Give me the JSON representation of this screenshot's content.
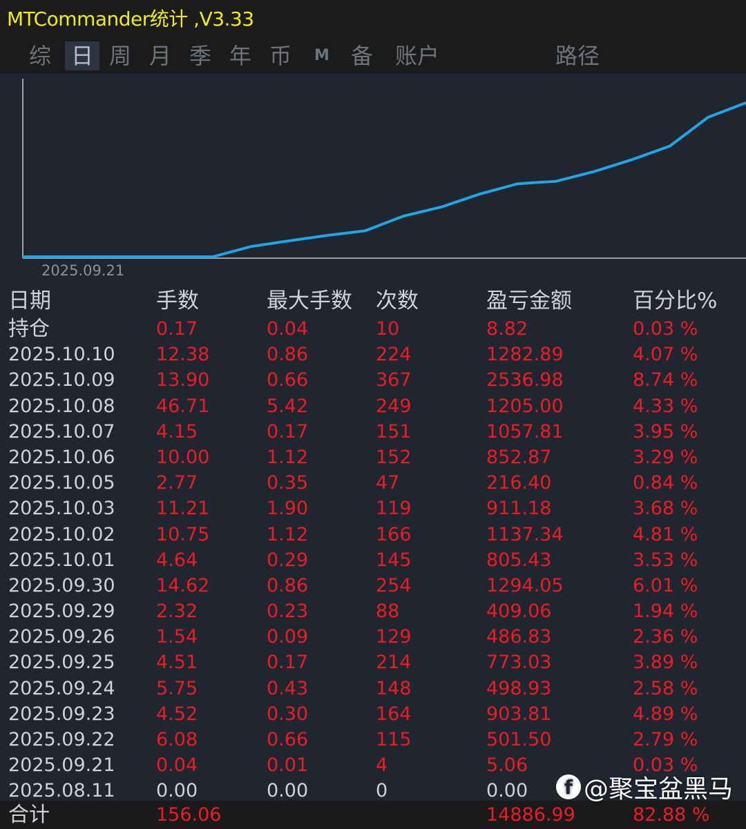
{
  "app": {
    "title": "MTCommander统计 ,V3.33"
  },
  "tabs": [
    {
      "label": "综",
      "active": false
    },
    {
      "label": "日",
      "active": true
    },
    {
      "label": "周",
      "active": false
    },
    {
      "label": "月",
      "active": false
    },
    {
      "label": "季",
      "active": false
    },
    {
      "label": "年",
      "active": false
    },
    {
      "label": "币",
      "active": false
    },
    {
      "label": "M",
      "active": false
    },
    {
      "label": "备",
      "active": false
    },
    {
      "label": "账户",
      "active": false
    },
    {
      "label": "路径",
      "active": false
    }
  ],
  "colors": {
    "title": "#f0f000",
    "line": "#1ea7e6",
    "profit": "#ec1c24",
    "text": "#cfd2d6",
    "background": "#202630"
  },
  "chart_data": {
    "type": "line",
    "x_start_label": "2025.09.21",
    "series": [
      {
        "values": [
          0,
          0,
          0,
          0,
          0,
          5.06,
          906.87,
          1405.8,
          1892.63,
          2301.69,
          3595.74,
          4401.17,
          5538.51,
          6449.69,
          6666.09,
          7518.96,
          8576.77,
          9781.77,
          12318.75,
          13601.64
        ]
      }
    ]
  },
  "table": {
    "headers": [
      "日期",
      "手数",
      "最大手数",
      "次数",
      "盈亏金额",
      "百分比%"
    ],
    "rows": [
      {
        "date": "持仓",
        "lots": "0.17",
        "max_lots": "0.04",
        "count": "10",
        "pnl": "8.82",
        "pct": "0.03 %",
        "red": true
      },
      {
        "date": "2025.10.10",
        "lots": "12.38",
        "max_lots": "0.86",
        "count": "224",
        "pnl": "1282.89",
        "pct": "4.07 %",
        "red": true
      },
      {
        "date": "2025.10.09",
        "lots": "13.90",
        "max_lots": "0.66",
        "count": "367",
        "pnl": "2536.98",
        "pct": "8.74 %",
        "red": true
      },
      {
        "date": "2025.10.08",
        "lots": "46.71",
        "max_lots": "5.42",
        "count": "249",
        "pnl": "1205.00",
        "pct": "4.33 %",
        "red": true
      },
      {
        "date": "2025.10.07",
        "lots": "4.15",
        "max_lots": "0.17",
        "count": "151",
        "pnl": "1057.81",
        "pct": "3.95 %",
        "red": true
      },
      {
        "date": "2025.10.06",
        "lots": "10.00",
        "max_lots": "1.12",
        "count": "152",
        "pnl": "852.87",
        "pct": "3.29 %",
        "red": true
      },
      {
        "date": "2025.10.05",
        "lots": "2.77",
        "max_lots": "0.35",
        "count": "47",
        "pnl": "216.40",
        "pct": "0.84 %",
        "red": true
      },
      {
        "date": "2025.10.03",
        "lots": "11.21",
        "max_lots": "1.90",
        "count": "119",
        "pnl": "911.18",
        "pct": "3.68 %",
        "red": true
      },
      {
        "date": "2025.10.02",
        "lots": "10.75",
        "max_lots": "1.12",
        "count": "166",
        "pnl": "1137.34",
        "pct": "4.81 %",
        "red": true
      },
      {
        "date": "2025.10.01",
        "lots": "4.64",
        "max_lots": "0.29",
        "count": "145",
        "pnl": "805.43",
        "pct": "3.53 %",
        "red": true
      },
      {
        "date": "2025.09.30",
        "lots": "14.62",
        "max_lots": "0.86",
        "count": "254",
        "pnl": "1294.05",
        "pct": "6.01 %",
        "red": true
      },
      {
        "date": "2025.09.29",
        "lots": "2.32",
        "max_lots": "0.23",
        "count": "88",
        "pnl": "409.06",
        "pct": "1.94 %",
        "red": true
      },
      {
        "date": "2025.09.26",
        "lots": "1.54",
        "max_lots": "0.09",
        "count": "129",
        "pnl": "486.83",
        "pct": "2.36 %",
        "red": true
      },
      {
        "date": "2025.09.25",
        "lots": "4.51",
        "max_lots": "0.17",
        "count": "214",
        "pnl": "773.03",
        "pct": "3.89 %",
        "red": true
      },
      {
        "date": "2025.09.24",
        "lots": "5.75",
        "max_lots": "0.43",
        "count": "148",
        "pnl": "498.93",
        "pct": "2.58 %",
        "red": true
      },
      {
        "date": "2025.09.23",
        "lots": "4.52",
        "max_lots": "0.30",
        "count": "164",
        "pnl": "903.81",
        "pct": "4.89 %",
        "red": true
      },
      {
        "date": "2025.09.22",
        "lots": "6.08",
        "max_lots": "0.66",
        "count": "115",
        "pnl": "501.50",
        "pct": "2.79 %",
        "red": true
      },
      {
        "date": "2025.09.21",
        "lots": "0.04",
        "max_lots": "0.01",
        "count": "4",
        "pnl": "5.06",
        "pct": "0.03 %",
        "red": true
      },
      {
        "date": "2025.08.11",
        "lots": "0.00",
        "max_lots": "0.00",
        "count": "0",
        "pnl": "0.00",
        "pct": "",
        "red": false
      }
    ],
    "total": {
      "label": "合计",
      "lots": "156.06",
      "pnl": "14886.99",
      "pct": "82.88 %"
    }
  },
  "watermark": {
    "icon": "facebook-icon",
    "icon_glyph": "f",
    "text": "@聚宝盆黑马"
  }
}
